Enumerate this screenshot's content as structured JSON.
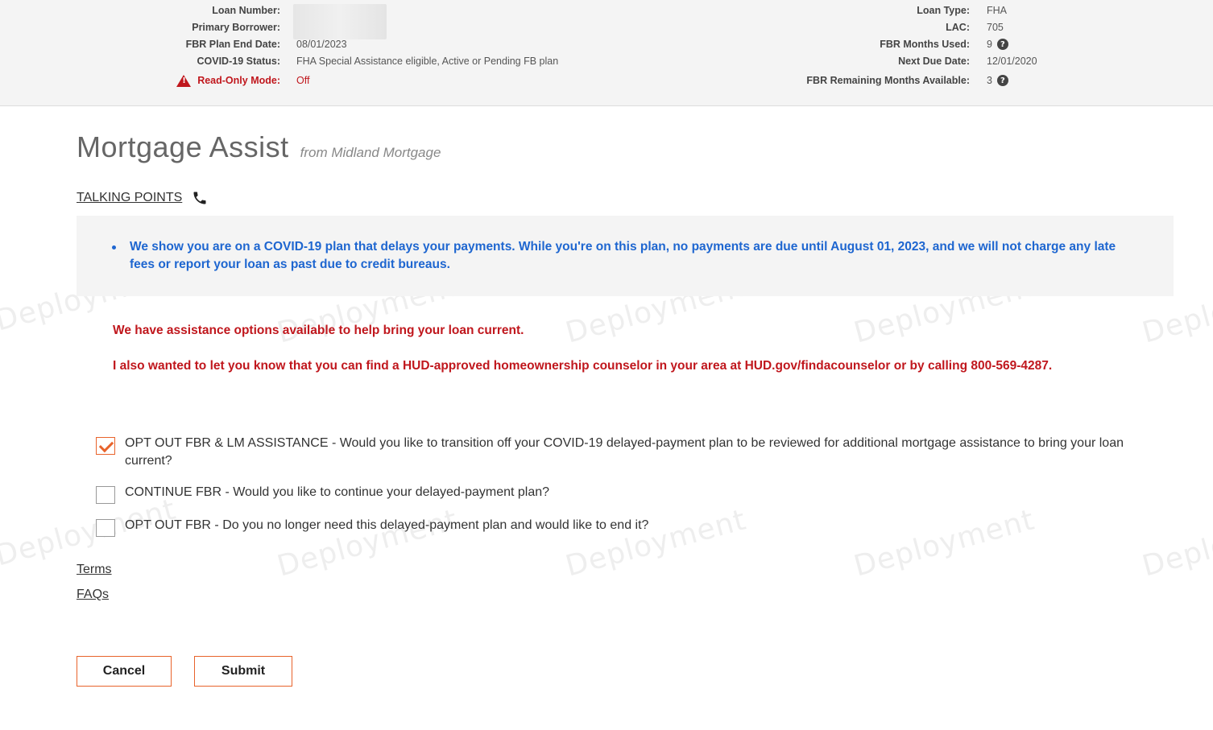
{
  "watermark": "Deployment",
  "header": {
    "left": [
      {
        "label": "Loan Number:",
        "value": ""
      },
      {
        "label": "Primary Borrower:",
        "value": ""
      },
      {
        "label": "FBR Plan End Date:",
        "value": "08/01/2023"
      },
      {
        "label": "COVID-19 Status:",
        "value": "FHA Special Assistance eligible, Active or Pending FB plan"
      },
      {
        "label": "Read-Only Mode:",
        "value": "Off"
      }
    ],
    "right": [
      {
        "label": "Loan Type:",
        "value": "FHA"
      },
      {
        "label": "LAC:",
        "value": "705"
      },
      {
        "label": "FBR Months Used:",
        "value": "9"
      },
      {
        "label": "Next Due Date:",
        "value": "12/01/2020"
      },
      {
        "label": "FBR Remaining Months Available:",
        "value": "3"
      }
    ],
    "help_glyph": "?"
  },
  "page": {
    "title": "Mortgage Assist",
    "subtitle": "from Midland Mortgage",
    "talking_points_label": "TALKING POINTS"
  },
  "notice": {
    "bullet": "We show you are on a COVID-19 plan that delays your payments. While you're on this plan, no payments are due until August 01, 2023, and we will not charge any late fees or report your loan as past due to credit bureaus."
  },
  "messages": {
    "assistance": "We have assistance options available to help bring your loan current.",
    "counselor": "I also wanted to let you know that you can find a HUD-approved homeownership counselor in your area at HUD.gov/findacounselor or by calling 800-569-4287."
  },
  "options": [
    {
      "label": "OPT OUT FBR & LM ASSISTANCE - Would you like to transition off your COVID-19 delayed-payment plan to be reviewed for additional mortgage assistance to bring your loan current?",
      "checked": true
    },
    {
      "label": "CONTINUE FBR - Would you like to continue your delayed-payment plan?",
      "checked": false
    },
    {
      "label": "OPT OUT FBR - Do you no longer need this delayed-payment plan and would like to end it?",
      "checked": false
    }
  ],
  "links": {
    "terms": "Terms",
    "faqs": "FAQs"
  },
  "buttons": {
    "cancel": "Cancel",
    "submit": "Submit"
  },
  "colors": {
    "accent": "#e8632b",
    "alert_red": "#c0171d",
    "info_blue": "#1e66d0"
  },
  "icons": {
    "phone": "phone-icon",
    "warning": "warning-icon",
    "help": "help-icon",
    "check": "check-icon"
  }
}
